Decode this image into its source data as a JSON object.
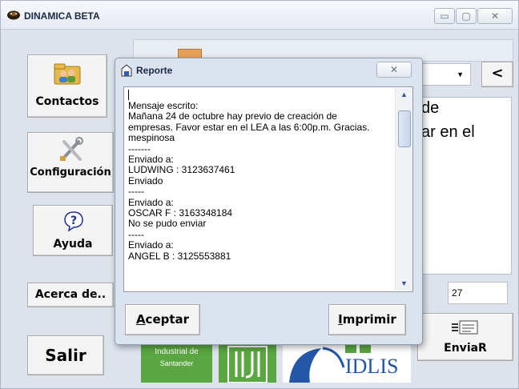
{
  "main_window": {
    "title": "DINAMICA BETA",
    "minimize_glyph": "▭",
    "maximize_glyph": "▢",
    "close_glyph": "✕"
  },
  "sidebar": {
    "contactos": "Contactos",
    "configuracion": "Configuración",
    "ayuda": "Ayuda",
    "acerca": "Acerca de..",
    "salir": "Salir"
  },
  "main": {
    "dropdown_arrow": "▼",
    "back_button": "<",
    "message_line_1": "de",
    "message_line_2": "ar en el",
    "counter_value": "27",
    "enviar_label": "EnviaR",
    "logo_text_1": "Industrial de",
    "logo_text_2": "Santander",
    "logo_text_3": "IDLIS"
  },
  "dialog": {
    "title": "Reporte",
    "close_glyph": "✕",
    "report_lines": [
      "Mensaje escrito:",
      "Mañana 24 de octubre hay previo de creación de",
      "empresas. Favor estar en el LEA a las 6:00p.m. Gracias.",
      "mespinosa",
      "-------",
      "Enviado a:",
      "LUDWING : 3123637461",
      "Enviado",
      "-----",
      "Enviado a:",
      "OSCAR F : 3163348184",
      "No se pudo enviar",
      "-----",
      "Enviado a:",
      "ANGEL B : 3125553881"
    ],
    "aceptar": "Aceptar",
    "imprimir": "Imprimir"
  }
}
